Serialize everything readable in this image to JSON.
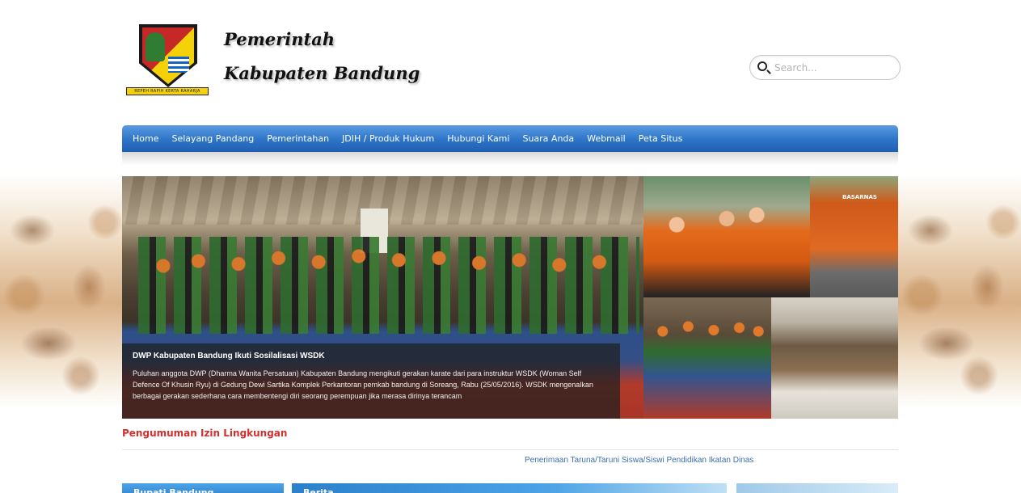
{
  "header": {
    "logo_motto": "REPEH RAPIH KERTA RAHARJA",
    "title_line1": "Pemerintah",
    "title_line2": "Kabupaten Bandung"
  },
  "search": {
    "placeholder": "Search..."
  },
  "nav": {
    "items": [
      {
        "label": "Home"
      },
      {
        "label": "Selayang Pandang"
      },
      {
        "label": "Pemerintahan"
      },
      {
        "label": "JDIH / Produk Hukum"
      },
      {
        "label": "Hubungi Kami"
      },
      {
        "label": "Suara Anda"
      },
      {
        "label": "Webmail"
      },
      {
        "label": "Peta Situs"
      }
    ]
  },
  "slider": {
    "caption_title": "DWP Kabupaten Bandung Ikuti Sosilalisasi WSDK",
    "caption_text": "Puluhan anggota DWP (Dharma Wanita Persatuan) Kabupaten Bandung mengikuti gerakan karate dari para instruktur WSDK (Woman Self Defence Of Khusin Ryu) di Gedung Dewi Sartika Komplek Perkantoran pemkab bandung di Soreang, Rabu (25/05/2016). WSDK mengenalkan berbagai gerakan sederhana cara membentengi diri seorang perempuan jika merasa dirinya terancam",
    "thumb2_label": "BASARNAS"
  },
  "announcement": {
    "title": "Pengumuman Izin Lingkungan",
    "ticker": "Penerimaan Taruna/Taruni Siswa/Siswi Pendidikan Ikatan Dinas"
  },
  "panels": {
    "p1": "Bupati Bandung",
    "p2": "Berita"
  }
}
